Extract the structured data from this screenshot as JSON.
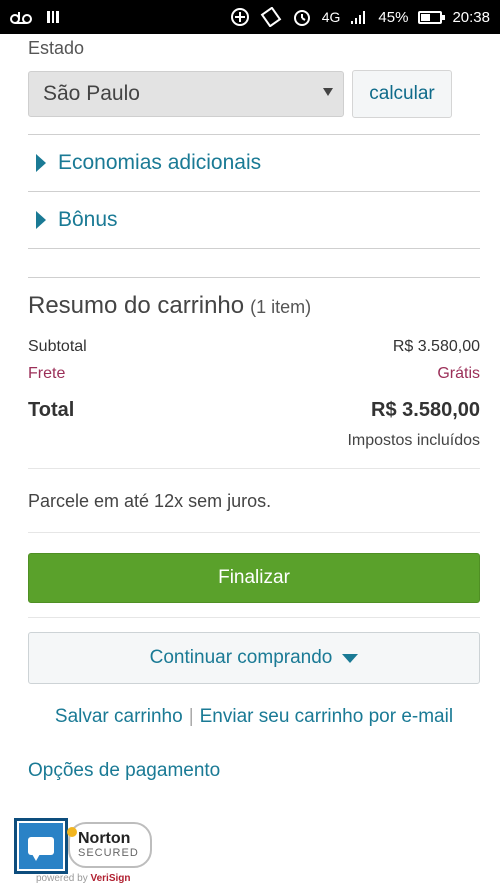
{
  "status_bar": {
    "left_icons": [
      "voicemail-icon",
      "notification-icon"
    ],
    "right_icons": [
      "data-saver-icon",
      "rotate-icon",
      "alarm-icon"
    ],
    "network": "4G",
    "battery": "45%",
    "battery_level": 0.45,
    "time": "20:38"
  },
  "shipping": {
    "estado_label": "Estado",
    "estado_value": "São Paulo",
    "calc_button": "calcular"
  },
  "expanders": [
    {
      "label": "Economias adicionais"
    },
    {
      "label": "Bônus"
    }
  ],
  "summary": {
    "title": "Resumo do carrinho",
    "item_count": "(1 item)",
    "subtotal_label": "Subtotal",
    "subtotal_value": "R$ 3.580,00",
    "frete_label": "Frete",
    "frete_value": "Grátis",
    "total_label": "Total",
    "total_value": "R$ 3.580,00",
    "taxes_note": "Impostos incluídos"
  },
  "installments": "Parcele em até 12x sem juros.",
  "actions": {
    "finalize": "Finalizar",
    "continue": "Continuar comprando",
    "save_cart": "Salvar carrinho",
    "separator": "|",
    "email_cart": "Enviar seu carrinho por e-mail",
    "payment_options": "Opções de pagamento"
  },
  "badges": {
    "norton_name": "Norton",
    "norton_sub": "SECURED",
    "powered_prefix": "powered by",
    "powered_brand": "VeriSign"
  },
  "colors": {
    "link": "#1a7a95",
    "finalize_green": "#5aa12b",
    "frete_color": "#9b2f58"
  }
}
